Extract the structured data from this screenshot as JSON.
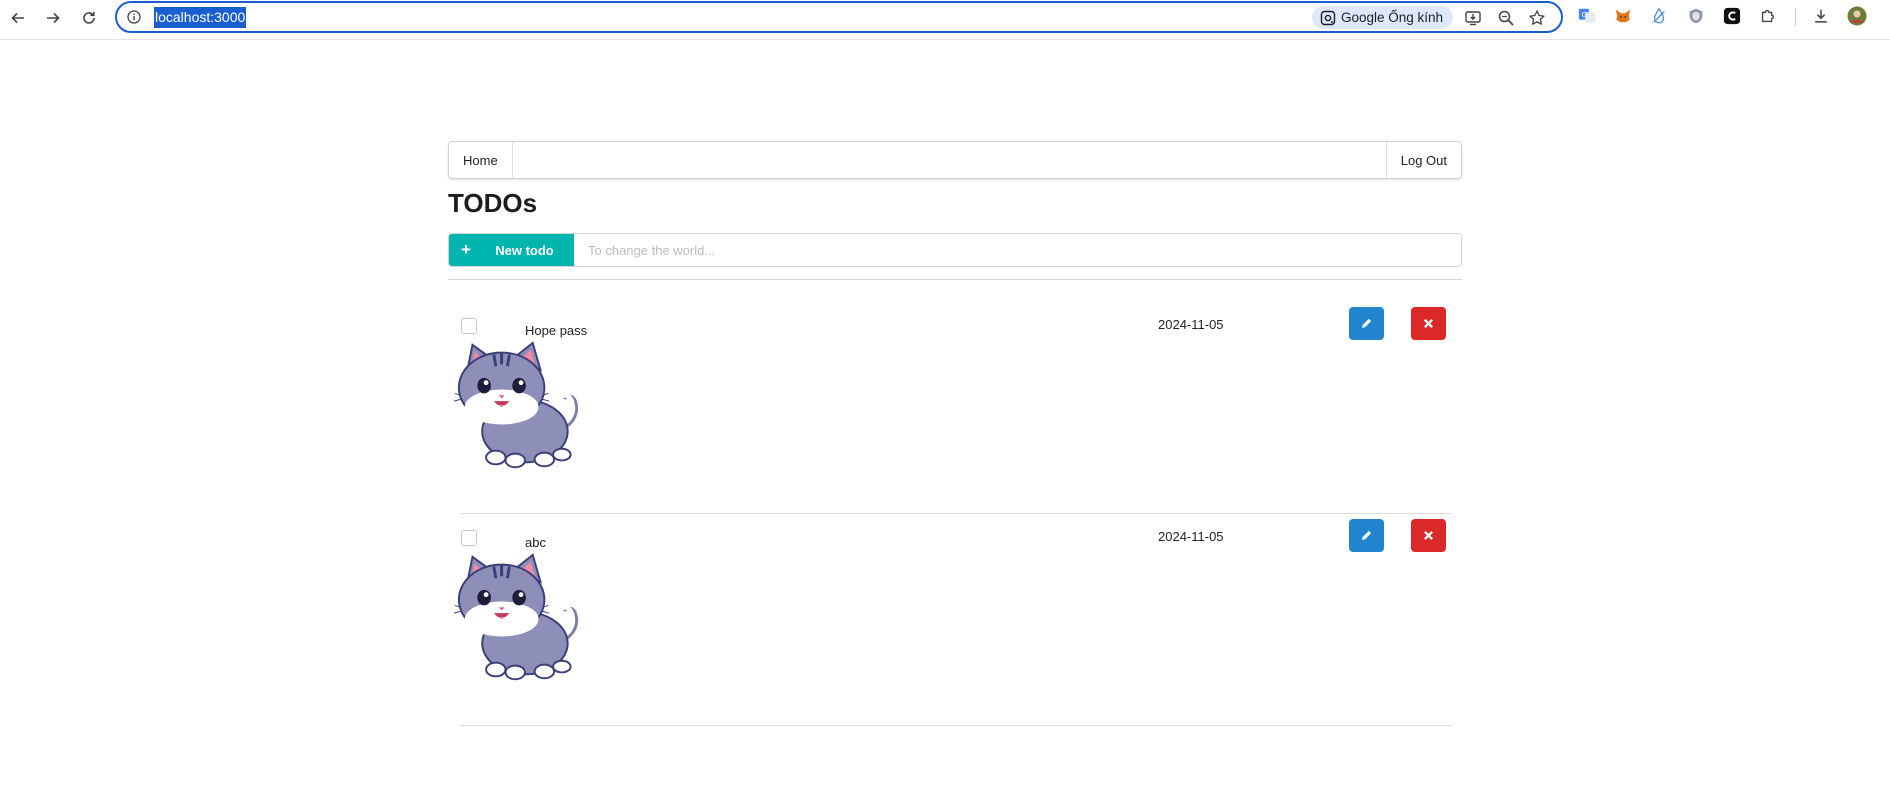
{
  "browser": {
    "url": "localhost:3000",
    "lens_label": "Google Ống kính"
  },
  "nav": {
    "home": "Home",
    "logout": "Log Out"
  },
  "page": {
    "title": "TODOs"
  },
  "new_todo": {
    "button_label": "New todo",
    "placeholder": "To change the world...",
    "value": ""
  },
  "todos": [
    {
      "title": "Hope pass",
      "date": "2024-11-05",
      "completed": false
    },
    {
      "title": "abc",
      "date": "2024-11-05",
      "completed": false
    }
  ],
  "colors": {
    "primary": "#00b5ad",
    "edit": "#2185d0",
    "delete": "#db2828",
    "omnibox_focus": "#1a5fd1"
  }
}
